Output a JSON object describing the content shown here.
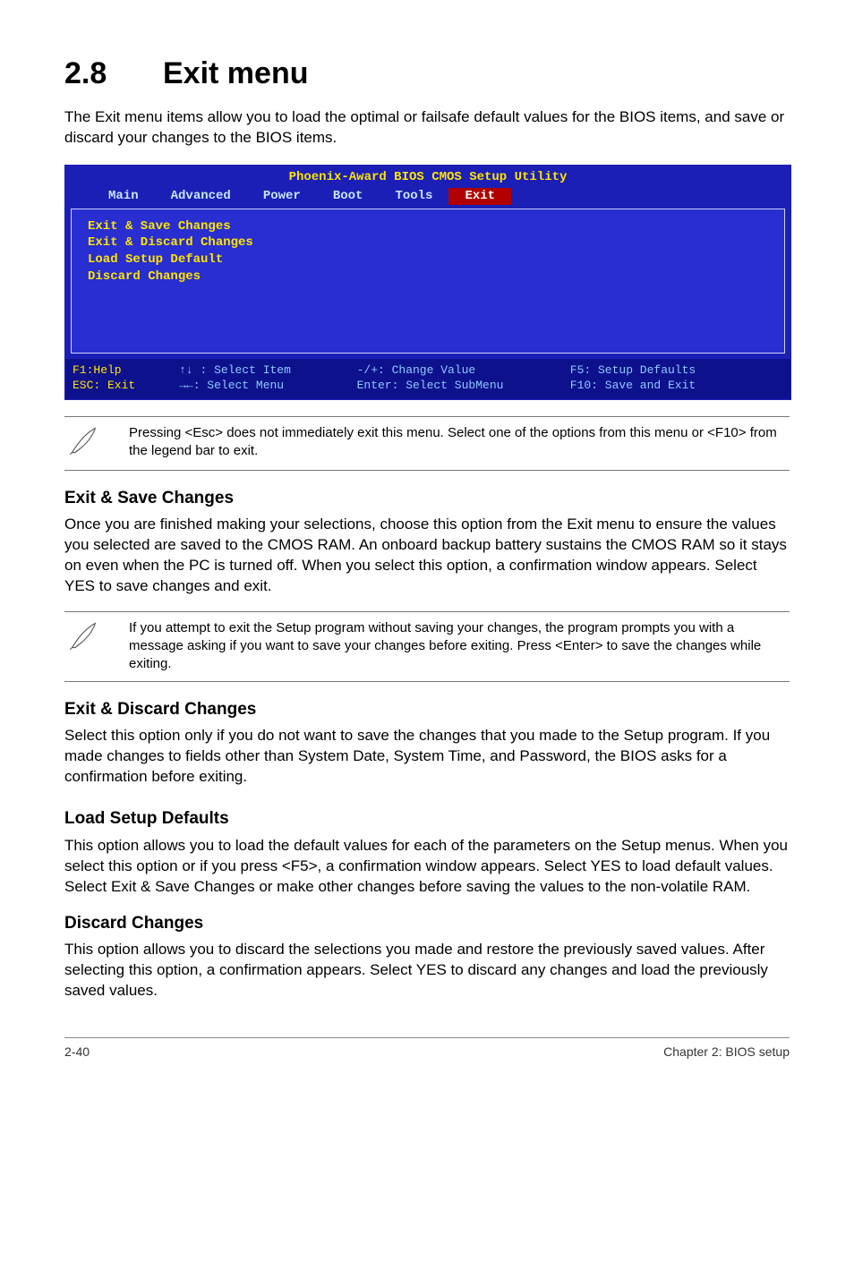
{
  "section": {
    "number": "2.8",
    "title": "Exit menu"
  },
  "intro": "The Exit menu items allow you to load the optimal or failsafe default values for the BIOS items, and save or discard your changes to the BIOS items.",
  "bios": {
    "title": "Phoenix-Award BIOS CMOS Setup Utility",
    "tabs": [
      "Main",
      "Advanced",
      "Power",
      "Boot",
      "Tools",
      "Exit"
    ],
    "active_tab": "Exit",
    "items": [
      "Exit & Save Changes",
      "Exit & Discard Changes",
      "Load Setup Default",
      "Discard Changes"
    ],
    "footer": {
      "help": "F1:Help",
      "esc": "ESC: Exit",
      "selitem": "↑↓ : Select Item",
      "selmenu": "→←: Select Menu",
      "change": "-/+: Change Value",
      "enter": "Enter: Select SubMenu",
      "defaults": "F5: Setup Defaults",
      "saveexit": "F10: Save and Exit"
    }
  },
  "note_esc": "Pressing <Esc> does not immediately exit this menu. Select one of the options from this menu or <F10> from the legend bar to exit.",
  "exit_save": {
    "title": "Exit & Save Changes",
    "body": "Once you are finished making your selections, choose this option from the Exit menu to ensure the values you selected are saved to the CMOS RAM. An onboard backup battery sustains the CMOS RAM so it stays on even when the PC is turned off. When you select this option, a confirmation window appears. Select YES to save changes and exit."
  },
  "note_attempt": " If you attempt to exit the Setup program without saving your changes, the program prompts you with a message asking if you want to save your changes before exiting. Press <Enter>  to save the  changes while exiting.",
  "exit_discard": {
    "title": "Exit & Discard Changes",
    "body": "Select this option only if you do not want to save the changes that you  made to the Setup program. If you made changes to fields other than System Date, System Time, and Password, the BIOS asks for a confirmation before exiting."
  },
  "load_defaults": {
    "title": "Load Setup Defaults",
    "body": "This option allows you to load the default values for each of the parameters on the Setup menus. When you select this option or if you press <F5>, a confirmation window appears. Select YES to load default values. Select Exit & Save Changes or make other changes before saving the values to the non-volatile RAM."
  },
  "discard": {
    "title": "Discard Changes",
    "body": "This option allows you to discard the selections you made and restore the previously saved values. After selecting this option, a confirmation appears. Select YES to discard any changes and load the previously saved values."
  },
  "footer": {
    "left": "2-40",
    "right": "Chapter 2: BIOS setup"
  }
}
